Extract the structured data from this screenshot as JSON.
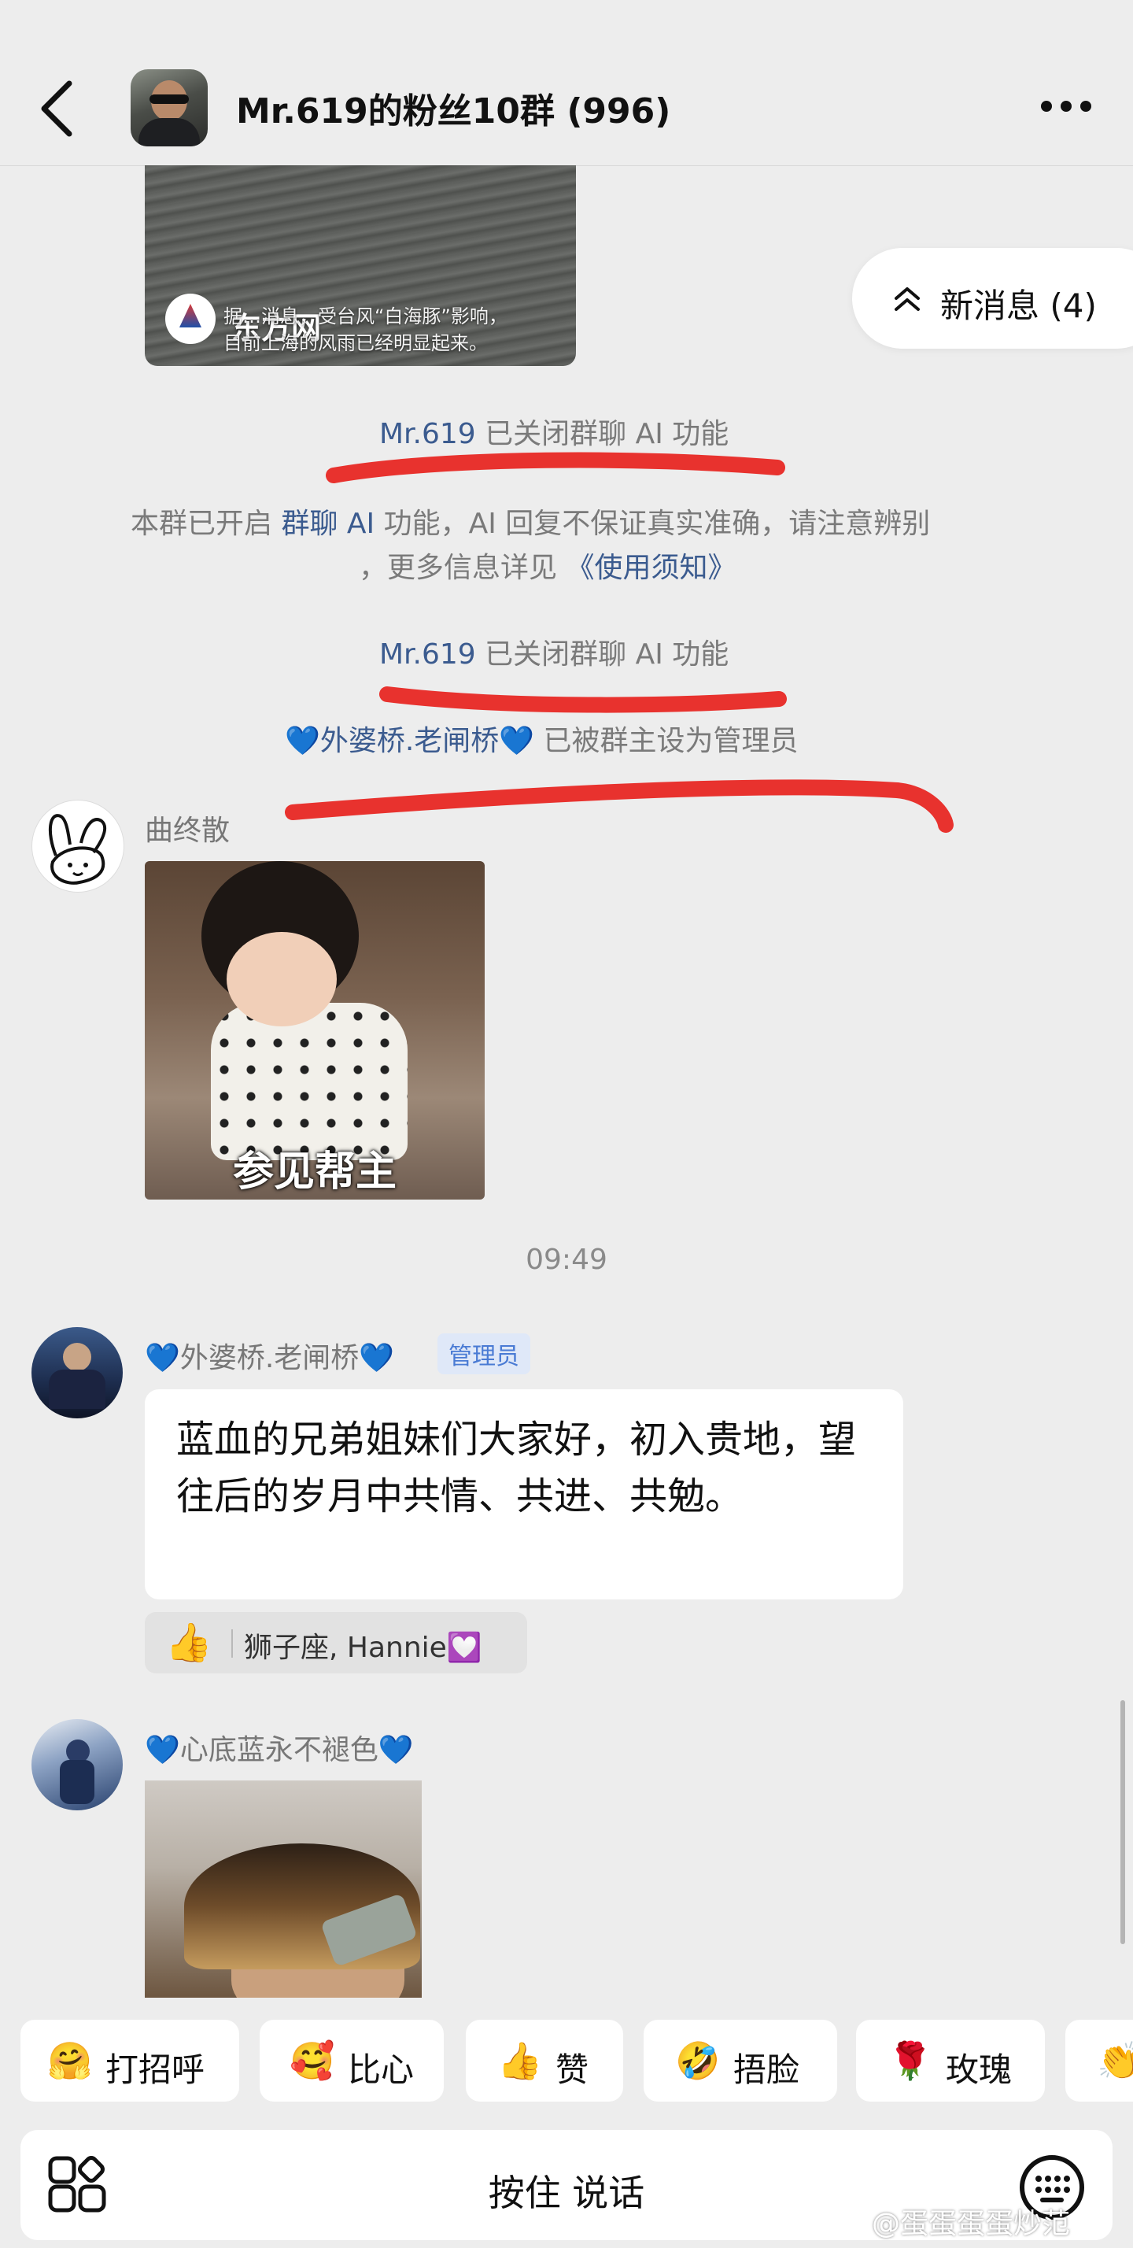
{
  "header": {
    "title": "Mr.619的粉丝10群 (996)"
  },
  "top_image": {
    "brand": "东方网",
    "caption_line1": "据…消息，受台风“白海豚”影响，",
    "caption_line2": "目前上海的风雨已经明显起来。"
  },
  "new_messages": {
    "label": "新消息 (4)"
  },
  "notices": {
    "n1": {
      "user": "Mr.619",
      "text": " 已关闭群聊 AI 功能"
    },
    "n2": {
      "pre": "本群已开启 ",
      "link1": "群聊 AI",
      "mid": " 功能，AI 回复不保证真实准确，请注意辨别",
      "line2_pre": "，更多信息详见 ",
      "link2": "《使用须知》"
    },
    "n3": {
      "user": "Mr.619",
      "text": " 已关闭群聊 AI 功能"
    },
    "n4": {
      "user": "💙外婆桥.老闸桥💙",
      "text": " 已被群主设为管理员"
    }
  },
  "messages": [
    {
      "sender": "曲终散",
      "meme_caption": "参见帮主"
    },
    {
      "sender": "💙外婆桥.老闸桥💙",
      "badge": "管理员",
      "text": "蓝血的兄弟姐妹们大家好，初入贵地，望往后的岁月中共情、共进、共勉。",
      "reaction_emoji": "👍",
      "reaction_names": "狮子座, Hannie💟"
    },
    {
      "sender": "💙心底蓝永不褪色💙"
    }
  ],
  "timestamp": "09:49",
  "quick_replies": [
    {
      "emoji": "🤗",
      "label": "打招呼"
    },
    {
      "emoji": "🥰",
      "label": "比心"
    },
    {
      "emoji": "👍",
      "label": "赞"
    },
    {
      "emoji": "🤣",
      "label": "捂脸"
    },
    {
      "emoji": "🌹",
      "label": "玫瑰"
    },
    {
      "emoji": "👏",
      "label": ""
    }
  ],
  "input": {
    "hold_to_talk": "按住 说话"
  },
  "watermark": "@蛋蛋蛋蛋炒范",
  "colors": {
    "background": "#ededed",
    "link": "#3b5b8f",
    "annotation_red": "#e8322e",
    "admin_badge": "#4a7bd4"
  }
}
